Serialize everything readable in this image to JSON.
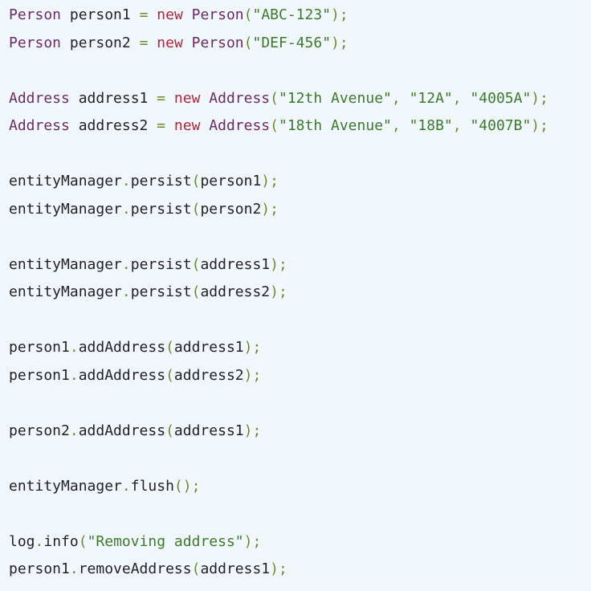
{
  "colors": {
    "background": "#f0f7fd",
    "type": "#6b2a68",
    "keyword": "#b0263a",
    "string": "#3d7a2a",
    "punctuation": "#6d8a2e",
    "text": "#222222"
  },
  "code": {
    "lines": [
      [
        {
          "t": "type",
          "v": "Person"
        },
        {
          "t": "plain",
          "v": " person1 "
        },
        {
          "t": "pun",
          "v": "="
        },
        {
          "t": "plain",
          "v": " "
        },
        {
          "t": "kw",
          "v": "new"
        },
        {
          "t": "plain",
          "v": " "
        },
        {
          "t": "type",
          "v": "Person"
        },
        {
          "t": "pun",
          "v": "("
        },
        {
          "t": "str",
          "v": "\"ABC-123\""
        },
        {
          "t": "pun",
          "v": ");"
        }
      ],
      [
        {
          "t": "type",
          "v": "Person"
        },
        {
          "t": "plain",
          "v": " person2 "
        },
        {
          "t": "pun",
          "v": "="
        },
        {
          "t": "plain",
          "v": " "
        },
        {
          "t": "kw",
          "v": "new"
        },
        {
          "t": "plain",
          "v": " "
        },
        {
          "t": "type",
          "v": "Person"
        },
        {
          "t": "pun",
          "v": "("
        },
        {
          "t": "str",
          "v": "\"DEF-456\""
        },
        {
          "t": "pun",
          "v": ");"
        }
      ],
      [],
      [
        {
          "t": "type",
          "v": "Address"
        },
        {
          "t": "plain",
          "v": " address1 "
        },
        {
          "t": "pun",
          "v": "="
        },
        {
          "t": "plain",
          "v": " "
        },
        {
          "t": "kw",
          "v": "new"
        },
        {
          "t": "plain",
          "v": " "
        },
        {
          "t": "type",
          "v": "Address"
        },
        {
          "t": "pun",
          "v": "("
        },
        {
          "t": "str",
          "v": "\"12th Avenue\""
        },
        {
          "t": "pun",
          "v": ","
        },
        {
          "t": "plain",
          "v": " "
        },
        {
          "t": "str",
          "v": "\"12A\""
        },
        {
          "t": "pun",
          "v": ","
        },
        {
          "t": "plain",
          "v": " "
        },
        {
          "t": "str",
          "v": "\"4005A\""
        },
        {
          "t": "pun",
          "v": ");"
        }
      ],
      [
        {
          "t": "type",
          "v": "Address"
        },
        {
          "t": "plain",
          "v": " address2 "
        },
        {
          "t": "pun",
          "v": "="
        },
        {
          "t": "plain",
          "v": " "
        },
        {
          "t": "kw",
          "v": "new"
        },
        {
          "t": "plain",
          "v": " "
        },
        {
          "t": "type",
          "v": "Address"
        },
        {
          "t": "pun",
          "v": "("
        },
        {
          "t": "str",
          "v": "\"18th Avenue\""
        },
        {
          "t": "pun",
          "v": ","
        },
        {
          "t": "plain",
          "v": " "
        },
        {
          "t": "str",
          "v": "\"18B\""
        },
        {
          "t": "pun",
          "v": ","
        },
        {
          "t": "plain",
          "v": " "
        },
        {
          "t": "str",
          "v": "\"4007B\""
        },
        {
          "t": "pun",
          "v": ");"
        }
      ],
      [],
      [
        {
          "t": "plain",
          "v": "entityManager"
        },
        {
          "t": "pun",
          "v": "."
        },
        {
          "t": "plain",
          "v": "persist"
        },
        {
          "t": "pun",
          "v": "("
        },
        {
          "t": "plain",
          "v": "person1"
        },
        {
          "t": "pun",
          "v": ");"
        }
      ],
      [
        {
          "t": "plain",
          "v": "entityManager"
        },
        {
          "t": "pun",
          "v": "."
        },
        {
          "t": "plain",
          "v": "persist"
        },
        {
          "t": "pun",
          "v": "("
        },
        {
          "t": "plain",
          "v": "person2"
        },
        {
          "t": "pun",
          "v": ");"
        }
      ],
      [],
      [
        {
          "t": "plain",
          "v": "entityManager"
        },
        {
          "t": "pun",
          "v": "."
        },
        {
          "t": "plain",
          "v": "persist"
        },
        {
          "t": "pun",
          "v": "("
        },
        {
          "t": "plain",
          "v": "address1"
        },
        {
          "t": "pun",
          "v": ");"
        }
      ],
      [
        {
          "t": "plain",
          "v": "entityManager"
        },
        {
          "t": "pun",
          "v": "."
        },
        {
          "t": "plain",
          "v": "persist"
        },
        {
          "t": "pun",
          "v": "("
        },
        {
          "t": "plain",
          "v": "address2"
        },
        {
          "t": "pun",
          "v": ");"
        }
      ],
      [],
      [
        {
          "t": "plain",
          "v": "person1"
        },
        {
          "t": "pun",
          "v": "."
        },
        {
          "t": "plain",
          "v": "addAddress"
        },
        {
          "t": "pun",
          "v": "("
        },
        {
          "t": "plain",
          "v": "address1"
        },
        {
          "t": "pun",
          "v": ");"
        }
      ],
      [
        {
          "t": "plain",
          "v": "person1"
        },
        {
          "t": "pun",
          "v": "."
        },
        {
          "t": "plain",
          "v": "addAddress"
        },
        {
          "t": "pun",
          "v": "("
        },
        {
          "t": "plain",
          "v": "address2"
        },
        {
          "t": "pun",
          "v": ");"
        }
      ],
      [],
      [
        {
          "t": "plain",
          "v": "person2"
        },
        {
          "t": "pun",
          "v": "."
        },
        {
          "t": "plain",
          "v": "addAddress"
        },
        {
          "t": "pun",
          "v": "("
        },
        {
          "t": "plain",
          "v": "address1"
        },
        {
          "t": "pun",
          "v": ");"
        }
      ],
      [],
      [
        {
          "t": "plain",
          "v": "entityManager"
        },
        {
          "t": "pun",
          "v": "."
        },
        {
          "t": "plain",
          "v": "flush"
        },
        {
          "t": "pun",
          "v": "();"
        }
      ],
      [],
      [
        {
          "t": "plain",
          "v": "log"
        },
        {
          "t": "pun",
          "v": "."
        },
        {
          "t": "plain",
          "v": "info"
        },
        {
          "t": "pun",
          "v": "("
        },
        {
          "t": "str",
          "v": "\"Removing address\""
        },
        {
          "t": "pun",
          "v": ");"
        }
      ],
      [
        {
          "t": "plain",
          "v": "person1"
        },
        {
          "t": "pun",
          "v": "."
        },
        {
          "t": "plain",
          "v": "removeAddress"
        },
        {
          "t": "pun",
          "v": "("
        },
        {
          "t": "plain",
          "v": "address1"
        },
        {
          "t": "pun",
          "v": ");"
        }
      ]
    ]
  }
}
